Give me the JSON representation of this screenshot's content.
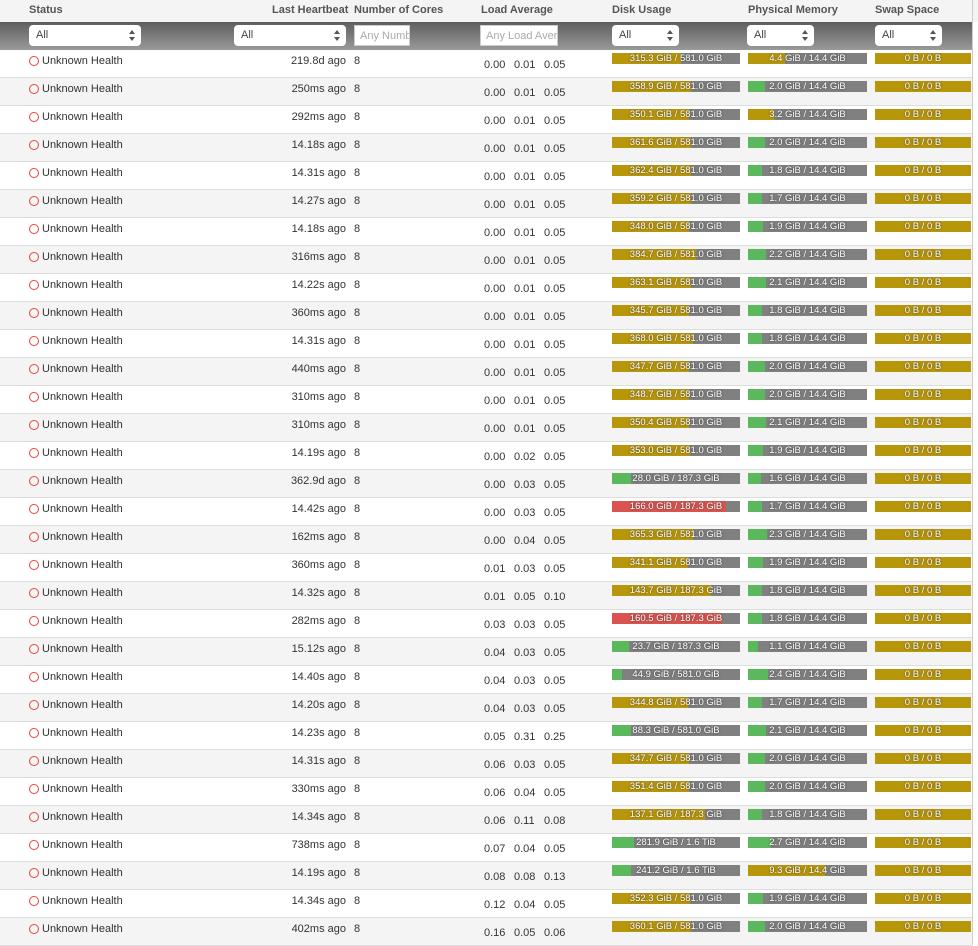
{
  "colors": {
    "ok": "#5cb85c",
    "warn": "#b8960a",
    "danger": "#d9534f",
    "track": "#808080",
    "status_icon": "#e8453c"
  },
  "columns": {
    "status": "Status",
    "heartbeat": "Last Heartbeat",
    "cores": "Number of Cores",
    "load": "Load Average",
    "disk": "Disk Usage",
    "memory": "Physical Memory",
    "swap": "Swap Space"
  },
  "filters": {
    "status": "All",
    "heartbeat": "All",
    "cores_placeholder": "Any Number",
    "load_placeholder": "Any Load Average",
    "disk": "All",
    "memory": "All",
    "swap": "All"
  },
  "rows": [
    {
      "status": "Unknown Health",
      "heartbeat": "219.8d ago",
      "cores": "8",
      "load": [
        "0.00",
        "0.01",
        "0.05"
      ],
      "disk": "315.3 GiB / 581.0 GiB",
      "disk_pct": 54,
      "mem": "4.4 GiB / 14.4 GiB",
      "mem_pct": 31,
      "swap": "0 B / 0 B"
    },
    {
      "status": "Unknown Health",
      "heartbeat": "250ms ago",
      "cores": "8",
      "load": [
        "0.00",
        "0.01",
        "0.05"
      ],
      "disk": "358.9 GiB / 581.0 GiB",
      "disk_pct": 62,
      "mem": "2.0 GiB / 14.4 GiB",
      "mem_pct": 14,
      "swap": "0 B / 0 B"
    },
    {
      "status": "Unknown Health",
      "heartbeat": "292ms ago",
      "cores": "8",
      "load": [
        "0.00",
        "0.01",
        "0.05"
      ],
      "disk": "350.1 GiB / 581.0 GiB",
      "disk_pct": 60,
      "mem": "3.2 GiB / 14.4 GiB",
      "mem_pct": 22,
      "swap": "0 B / 0 B"
    },
    {
      "status": "Unknown Health",
      "heartbeat": "14.18s ago",
      "cores": "8",
      "load": [
        "0.00",
        "0.01",
        "0.05"
      ],
      "disk": "361.6 GiB / 581.0 GiB",
      "disk_pct": 62,
      "mem": "2.0 GiB / 14.4 GiB",
      "mem_pct": 14,
      "swap": "0 B / 0 B"
    },
    {
      "status": "Unknown Health",
      "heartbeat": "14.31s ago",
      "cores": "8",
      "load": [
        "0.00",
        "0.01",
        "0.05"
      ],
      "disk": "362.4 GiB / 581.0 GiB",
      "disk_pct": 62,
      "mem": "1.8 GiB / 14.4 GiB",
      "mem_pct": 12,
      "swap": "0 B / 0 B"
    },
    {
      "status": "Unknown Health",
      "heartbeat": "14.27s ago",
      "cores": "8",
      "load": [
        "0.00",
        "0.01",
        "0.05"
      ],
      "disk": "359.2 GiB / 581.0 GiB",
      "disk_pct": 62,
      "mem": "1.7 GiB / 14.4 GiB",
      "mem_pct": 12,
      "swap": "0 B / 0 B"
    },
    {
      "status": "Unknown Health",
      "heartbeat": "14.18s ago",
      "cores": "8",
      "load": [
        "0.00",
        "0.01",
        "0.05"
      ],
      "disk": "348.0 GiB / 581.0 GiB",
      "disk_pct": 60,
      "mem": "1.9 GiB / 14.4 GiB",
      "mem_pct": 13,
      "swap": "0 B / 0 B"
    },
    {
      "status": "Unknown Health",
      "heartbeat": "316ms ago",
      "cores": "8",
      "load": [
        "0.00",
        "0.01",
        "0.05"
      ],
      "disk": "384.7 GiB / 581.0 GiB",
      "disk_pct": 66,
      "mem": "2.2 GiB / 14.4 GiB",
      "mem_pct": 15,
      "swap": "0 B / 0 B"
    },
    {
      "status": "Unknown Health",
      "heartbeat": "14.22s ago",
      "cores": "8",
      "load": [
        "0.00",
        "0.01",
        "0.05"
      ],
      "disk": "363.1 GiB / 581.0 GiB",
      "disk_pct": 62,
      "mem": "2.1 GiB / 14.4 GiB",
      "mem_pct": 15,
      "swap": "0 B / 0 B"
    },
    {
      "status": "Unknown Health",
      "heartbeat": "360ms ago",
      "cores": "8",
      "load": [
        "0.00",
        "0.01",
        "0.05"
      ],
      "disk": "345.7 GiB / 581.0 GiB",
      "disk_pct": 60,
      "mem": "1.8 GiB / 14.4 GiB",
      "mem_pct": 12,
      "swap": "0 B / 0 B"
    },
    {
      "status": "Unknown Health",
      "heartbeat": "14.31s ago",
      "cores": "8",
      "load": [
        "0.00",
        "0.01",
        "0.05"
      ],
      "disk": "368.0 GiB / 581.0 GiB",
      "disk_pct": 63,
      "mem": "1.8 GiB / 14.4 GiB",
      "mem_pct": 12,
      "swap": "0 B / 0 B"
    },
    {
      "status": "Unknown Health",
      "heartbeat": "440ms ago",
      "cores": "8",
      "load": [
        "0.00",
        "0.01",
        "0.05"
      ],
      "disk": "347.7 GiB / 581.0 GiB",
      "disk_pct": 60,
      "mem": "2.0 GiB / 14.4 GiB",
      "mem_pct": 14,
      "swap": "0 B / 0 B"
    },
    {
      "status": "Unknown Health",
      "heartbeat": "310ms ago",
      "cores": "8",
      "load": [
        "0.00",
        "0.01",
        "0.05"
      ],
      "disk": "348.7 GiB / 581.0 GiB",
      "disk_pct": 60,
      "mem": "2.0 GiB / 14.4 GiB",
      "mem_pct": 14,
      "swap": "0 B / 0 B"
    },
    {
      "status": "Unknown Health",
      "heartbeat": "310ms ago",
      "cores": "8",
      "load": [
        "0.00",
        "0.01",
        "0.05"
      ],
      "disk": "350.4 GiB / 581.0 GiB",
      "disk_pct": 60,
      "mem": "2.1 GiB / 14.4 GiB",
      "mem_pct": 15,
      "swap": "0 B / 0 B"
    },
    {
      "status": "Unknown Health",
      "heartbeat": "14.19s ago",
      "cores": "8",
      "load": [
        "0.00",
        "0.02",
        "0.05"
      ],
      "disk": "353.0 GiB / 581.0 GiB",
      "disk_pct": 61,
      "mem": "1.9 GiB / 14.4 GiB",
      "mem_pct": 13,
      "swap": "0 B / 0 B"
    },
    {
      "status": "Unknown Health",
      "heartbeat": "362.9d ago",
      "cores": "8",
      "load": [
        "0.00",
        "0.03",
        "0.05"
      ],
      "disk": "28.0 GiB / 187.3 GiB",
      "disk_pct": 15,
      "mem": "1.6 GiB / 14.4 GiB",
      "mem_pct": 11,
      "swap": "0 B / 0 B"
    },
    {
      "status": "Unknown Health",
      "heartbeat": "14.42s ago",
      "cores": "8",
      "load": [
        "0.00",
        "0.03",
        "0.05"
      ],
      "disk": "166.0 GiB / 187.3 GiB",
      "disk_pct": 89,
      "mem": "1.7 GiB / 14.4 GiB",
      "mem_pct": 12,
      "swap": "0 B / 0 B"
    },
    {
      "status": "Unknown Health",
      "heartbeat": "162ms ago",
      "cores": "8",
      "load": [
        "0.00",
        "0.04",
        "0.05"
      ],
      "disk": "365.3 GiB / 581.0 GiB",
      "disk_pct": 63,
      "mem": "2.3 GiB / 14.4 GiB",
      "mem_pct": 16,
      "swap": "0 B / 0 B"
    },
    {
      "status": "Unknown Health",
      "heartbeat": "360ms ago",
      "cores": "8",
      "load": [
        "0.01",
        "0.03",
        "0.05"
      ],
      "disk": "341.1 GiB / 581.0 GiB",
      "disk_pct": 59,
      "mem": "1.9 GiB / 14.4 GiB",
      "mem_pct": 13,
      "swap": "0 B / 0 B"
    },
    {
      "status": "Unknown Health",
      "heartbeat": "14.32s ago",
      "cores": "8",
      "load": [
        "0.01",
        "0.05",
        "0.10"
      ],
      "disk": "143.7 GiB / 187.3 GiB",
      "disk_pct": 77,
      "mem": "1.8 GiB / 14.4 GiB",
      "mem_pct": 12,
      "swap": "0 B / 0 B"
    },
    {
      "status": "Unknown Health",
      "heartbeat": "282ms ago",
      "cores": "8",
      "load": [
        "0.03",
        "0.03",
        "0.05"
      ],
      "disk": "160.5 GiB / 187.3 GiB",
      "disk_pct": 86,
      "mem": "1.8 GiB / 14.4 GiB",
      "mem_pct": 12,
      "swap": "0 B / 0 B"
    },
    {
      "status": "Unknown Health",
      "heartbeat": "15.12s ago",
      "cores": "8",
      "load": [
        "0.04",
        "0.03",
        "0.05"
      ],
      "disk": "23.7 GiB / 187.3 GiB",
      "disk_pct": 13,
      "mem": "1.1 GiB / 14.4 GiB",
      "mem_pct": 8,
      "swap": "0 B / 0 B"
    },
    {
      "status": "Unknown Health",
      "heartbeat": "14.40s ago",
      "cores": "8",
      "load": [
        "0.04",
        "0.03",
        "0.05"
      ],
      "disk": "44.9 GiB / 581.0 GiB",
      "disk_pct": 8,
      "mem": "2.4 GiB / 14.4 GiB",
      "mem_pct": 17,
      "swap": "0 B / 0 B"
    },
    {
      "status": "Unknown Health",
      "heartbeat": "14.20s ago",
      "cores": "8",
      "load": [
        "0.04",
        "0.03",
        "0.05"
      ],
      "disk": "344.8 GiB / 581.0 GiB",
      "disk_pct": 59,
      "mem": "1.7 GiB / 14.4 GiB",
      "mem_pct": 12,
      "swap": "0 B / 0 B"
    },
    {
      "status": "Unknown Health",
      "heartbeat": "14.23s ago",
      "cores": "8",
      "load": [
        "0.05",
        "0.31",
        "0.25"
      ],
      "disk": "88.3 GiB / 581.0 GiB",
      "disk_pct": 15,
      "mem": "2.1 GiB / 14.4 GiB",
      "mem_pct": 15,
      "swap": "0 B / 0 B"
    },
    {
      "status": "Unknown Health",
      "heartbeat": "14.31s ago",
      "cores": "8",
      "load": [
        "0.06",
        "0.03",
        "0.05"
      ],
      "disk": "347.7 GiB / 581.0 GiB",
      "disk_pct": 60,
      "mem": "2.0 GiB / 14.4 GiB",
      "mem_pct": 14,
      "swap": "0 B / 0 B"
    },
    {
      "status": "Unknown Health",
      "heartbeat": "330ms ago",
      "cores": "8",
      "load": [
        "0.06",
        "0.04",
        "0.05"
      ],
      "disk": "351.4 GiB / 581.0 GiB",
      "disk_pct": 60,
      "mem": "2.0 GiB / 14.4 GiB",
      "mem_pct": 14,
      "swap": "0 B / 0 B"
    },
    {
      "status": "Unknown Health",
      "heartbeat": "14.34s ago",
      "cores": "8",
      "load": [
        "0.06",
        "0.11",
        "0.08"
      ],
      "disk": "137.1 GiB / 187.3 GiB",
      "disk_pct": 73,
      "mem": "1.8 GiB / 14.4 GiB",
      "mem_pct": 12,
      "swap": "0 B / 0 B"
    },
    {
      "status": "Unknown Health",
      "heartbeat": "738ms ago",
      "cores": "8",
      "load": [
        "0.07",
        "0.04",
        "0.05"
      ],
      "disk": "281.9 GiB / 1.6 TiB",
      "disk_pct": 17,
      "mem": "2.7 GiB / 14.4 GiB",
      "mem_pct": 19,
      "swap": "0 B / 0 B"
    },
    {
      "status": "Unknown Health",
      "heartbeat": "14.19s ago",
      "cores": "8",
      "load": [
        "0.08",
        "0.08",
        "0.13"
      ],
      "disk": "241.2 GiB / 1.6 TiB",
      "disk_pct": 15,
      "mem": "9.3 GiB / 14.4 GiB",
      "mem_pct": 65,
      "swap": "0 B / 0 B"
    },
    {
      "status": "Unknown Health",
      "heartbeat": "14.34s ago",
      "cores": "8",
      "load": [
        "0.12",
        "0.04",
        "0.05"
      ],
      "disk": "352.3 GiB / 581.0 GiB",
      "disk_pct": 61,
      "mem": "1.9 GiB / 14.4 GiB",
      "mem_pct": 13,
      "swap": "0 B / 0 B"
    },
    {
      "status": "Unknown Health",
      "heartbeat": "402ms ago",
      "cores": "8",
      "load": [
        "0.16",
        "0.05",
        "0.06"
      ],
      "disk": "360.1 GiB / 581.0 GiB",
      "disk_pct": 62,
      "mem": "2.0 GiB / 14.4 GiB",
      "mem_pct": 14,
      "swap": "0 B / 0 B"
    }
  ]
}
